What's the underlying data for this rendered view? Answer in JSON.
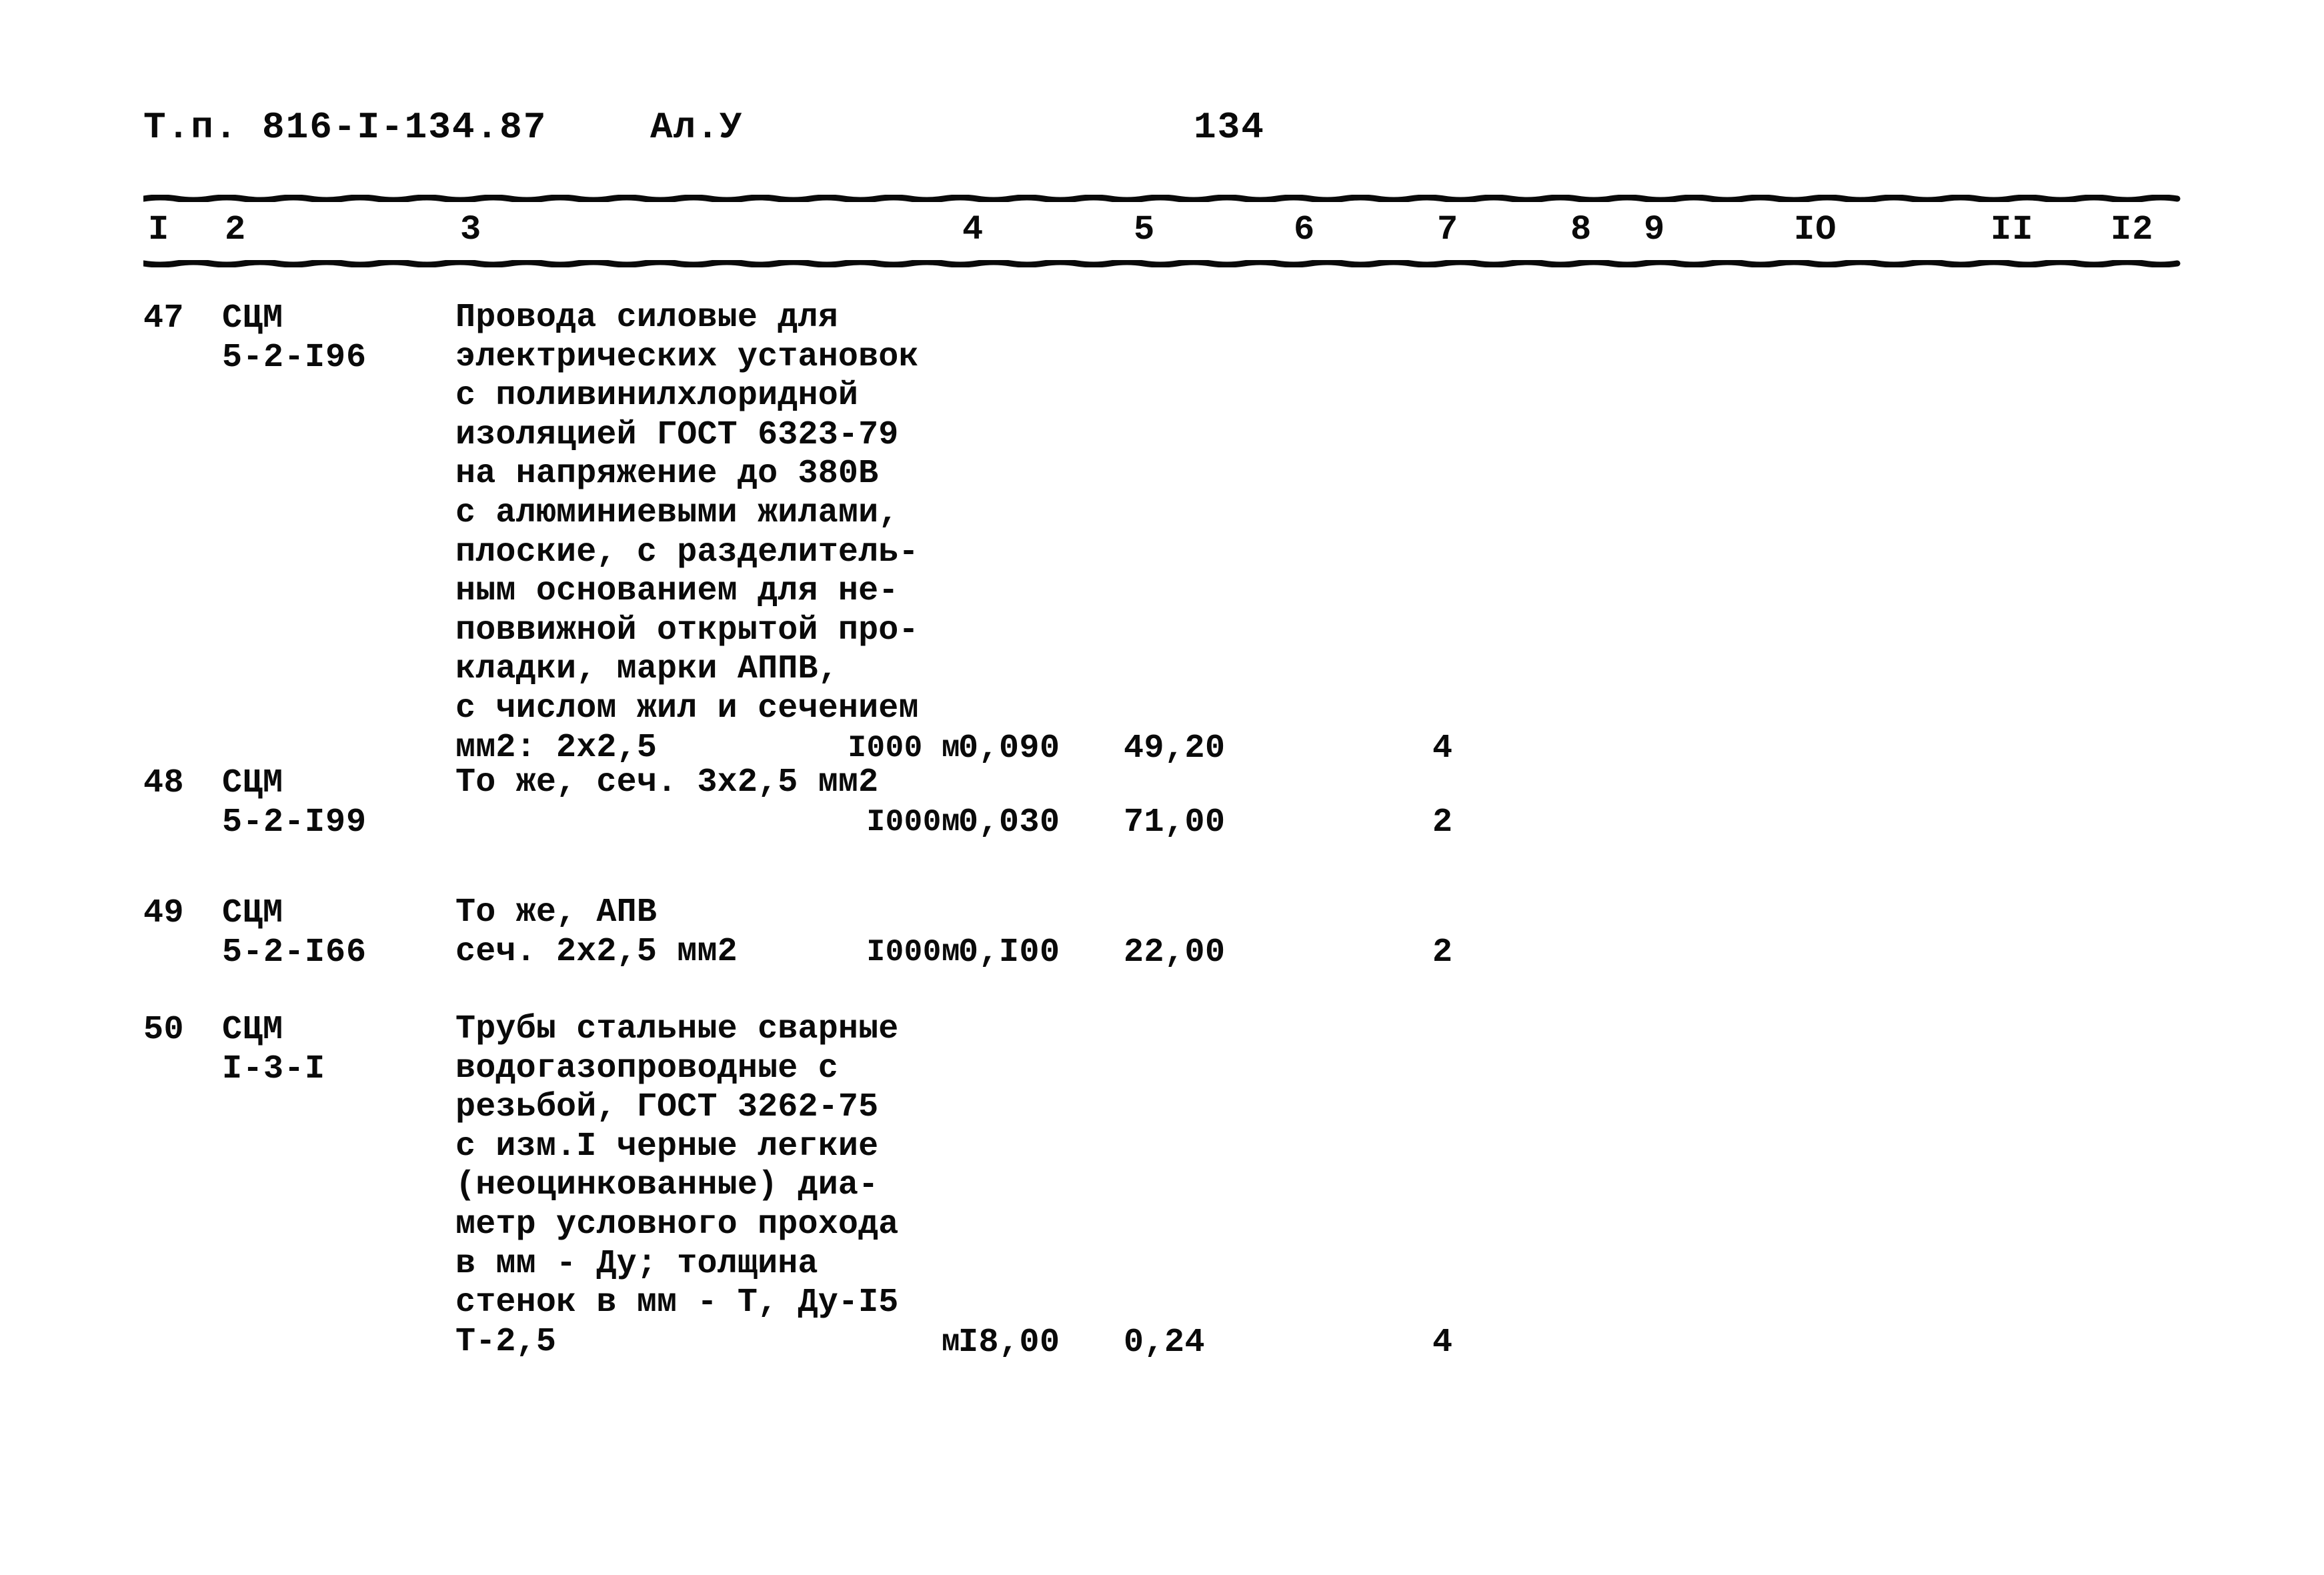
{
  "document": {
    "header": {
      "code": "Т.п. 816-I-134.87",
      "album": "Ал.У",
      "page": "134"
    },
    "column_numbers": [
      "I",
      "2",
      "3",
      "4",
      "5",
      "6",
      "7",
      "8",
      "9",
      "IO",
      "II",
      "I2"
    ],
    "rows": [
      {
        "number": "47",
        "code_line1": "СЦМ",
        "code_line2": "5-2-I96",
        "description": "Провода силовые для\nэлектрических установок\nс поливинилхлоридной\nизоляцией ГОСТ 6323-79\nна напряжение до 380В\nс алюминиевыми жилами,\nплоские, с разделитель-\nным основанием для не-\nповвижной открытой про-\nкладки, марки АППВ,\nс числом жил и сечением\nмм2: 2х2,5",
        "unit": "I000 м",
        "quantity": "0,090",
        "price": "49,20",
        "col7": "4"
      },
      {
        "number": "48",
        "code_line1": "СЦМ",
        "code_line2": "5-2-I99",
        "description": "То же, сеч. 3х2,5 мм2",
        "unit": "I000м",
        "quantity": "0,030",
        "price": "71,00",
        "col7": "2"
      },
      {
        "number": "49",
        "code_line1": "СЦМ",
        "code_line2": "5-2-I66",
        "description": "То же,   АПВ\nсеч. 2х2,5 мм2",
        "unit": "I000м",
        "quantity": "0,I00",
        "price": "22,00",
        "col7": "2"
      },
      {
        "number": "50",
        "code_line1": "СЦМ",
        "code_line2": "I-3-I",
        "description": "Трубы стальные сварные\nводогазопроводные с\nрезьбой, ГОСТ 3262-75\nс изм.I черные легкие\n(неоцинкованные) диа-\nметр условного прохода\nв мм - Ду; толщина\nстенок в мм - Т, Ду-I5\nТ-2,5",
        "unit": "м",
        "quantity": "I8,00",
        "price": "0,24",
        "col7": "4"
      }
    ]
  },
  "colors": {
    "ink": "#0a0a0a",
    "paper": "#ffffff"
  }
}
